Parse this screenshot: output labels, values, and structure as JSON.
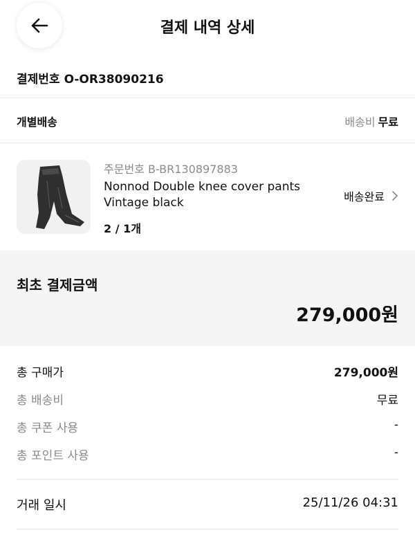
{
  "header": {
    "title": "결제 내역 상세",
    "back_icon": "arrow-left-icon"
  },
  "order": {
    "label": "결제번호",
    "number": "O-OR38090216"
  },
  "shipping": {
    "type": "개별배송",
    "fee_label": "배송비",
    "fee_value": "무료"
  },
  "product": {
    "order_label": "주문번호",
    "order_number": "B-BR130897883",
    "name": "Nonnod Double knee cover pants Vintage black",
    "quantity": "2 / 1개",
    "status": "배송완료",
    "status_icon": "chevron-right-icon"
  },
  "summary": {
    "label": "최초 결제금액",
    "amount": "279,000원"
  },
  "breakdown": [
    {
      "label": "총 구매가",
      "value": "279,000원"
    },
    {
      "label": "총 배송비",
      "value": "무료"
    },
    {
      "label": "총 쿠폰 사용",
      "value": "-"
    },
    {
      "label": "총 포인트 사용",
      "value": "-"
    }
  ],
  "transaction": {
    "label": "거래 일시",
    "value": "25/11/26 04:31"
  }
}
